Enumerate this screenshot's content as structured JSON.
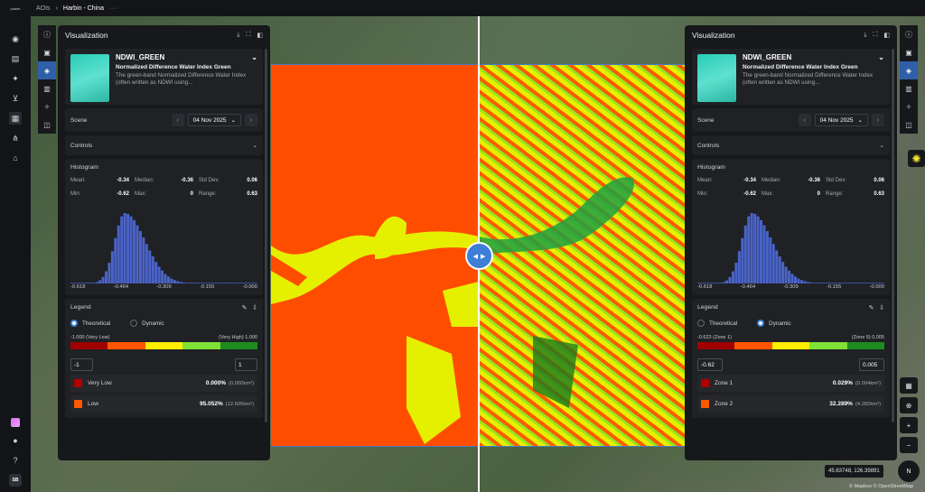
{
  "topbar": {
    "crumb1": "AOIs",
    "crumb2": "Harbin - China",
    "more": "···",
    "logo": "planet"
  },
  "user": {
    "initials": "SB"
  },
  "left_panel": {
    "title": "Visualization",
    "index": {
      "code": "NDWI_GREEN",
      "full_name": "Normalized Difference Water Index Green",
      "description": "The green-band Normalized Difference Water Index (often written as NDWI using..."
    },
    "scene_label": "Scene",
    "scene_date": "04 Nov 2025",
    "controls_label": "Controls",
    "histogram": {
      "title": "Histogram",
      "mean_label": "Mean:",
      "mean": "-0.34",
      "median_label": "Median:",
      "median": "-0.36",
      "std_label": "Std Dev:",
      "std": "0.06",
      "min_label": "Min:",
      "min": "-0.62",
      "max_label": "Max:",
      "max": "0",
      "range_label": "Range:",
      "range": "0.63",
      "ticks": [
        "-0.618",
        "-0.464",
        "-0.309",
        "-0.155",
        "-0.000"
      ]
    },
    "legend": {
      "title": "Legend",
      "opt1": "Theoretical",
      "opt2": "Dynamic",
      "selected": "Theoretical",
      "low_label": "-1.000 (Very Low)",
      "high_label": "(Very High) 1.000",
      "min_value": "-1",
      "max_value": "1",
      "classes": [
        {
          "label": "Very Low",
          "pct": "0.000%",
          "area": "(0.000km²)",
          "color": "#b00000"
        },
        {
          "label": "Low",
          "pct": "95.052%",
          "area": "(12.605km²)",
          "color": "#ff5a00"
        }
      ]
    }
  },
  "right_panel": {
    "title": "Visualization",
    "index": {
      "code": "NDWI_GREEN",
      "full_name": "Normalized Difference Water Index Green",
      "description": "The green-band Normalized Difference Water Index (often written as NDWI using..."
    },
    "scene_label": "Scene",
    "scene_date": "04 Nov 2025",
    "controls_label": "Controls",
    "histogram": {
      "title": "Histogram",
      "mean_label": "Mean:",
      "mean": "-0.34",
      "median_label": "Median:",
      "median": "-0.36",
      "std_label": "Std Dev:",
      "std": "0.06",
      "min_label": "Min:",
      "min": "-0.62",
      "max_label": "Max:",
      "max": "0",
      "range_label": "Range:",
      "range": "0.63",
      "ticks": [
        "-0.618",
        "-0.464",
        "-0.309",
        "-0.155",
        "-0.000"
      ]
    },
    "legend": {
      "title": "Legend",
      "opt1": "Theoretical",
      "opt2": "Dynamic",
      "selected": "Dynamic",
      "low_label": "-0.623 (Zone 1)",
      "high_label": "(Zone 5) 0.005",
      "min_value": "-0.62",
      "max_value": "0.005",
      "classes": [
        {
          "label": "Zone 1",
          "pct": "0.029%",
          "area": "(0.004km²)",
          "color": "#b00000"
        },
        {
          "label": "Zone 2",
          "pct": "32.289%",
          "area": "(4.282km²)",
          "color": "#ff5a00"
        }
      ]
    }
  },
  "scale_colors": [
    "#a00000",
    "#ff5500",
    "#ffee00",
    "#7fe035",
    "#1e8c1e"
  ],
  "map": {
    "coords": "45.63748, 126.39891",
    "attribution": "© Mapbox © OpenStreetMap",
    "compass": "N"
  }
}
